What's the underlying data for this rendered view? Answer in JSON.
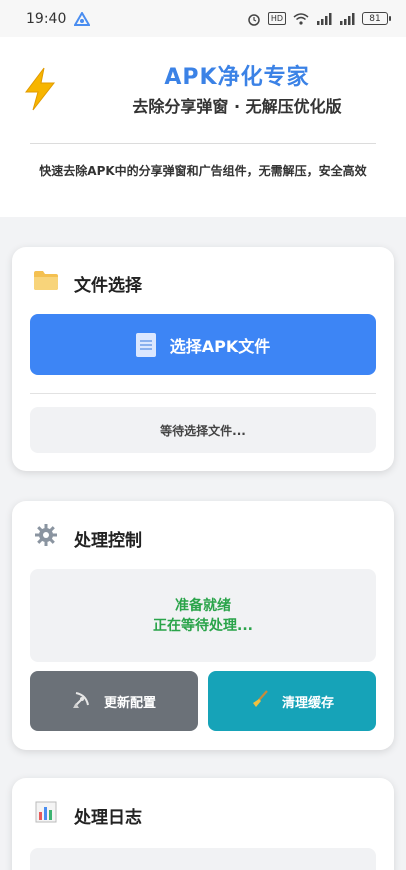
{
  "status_bar": {
    "time": "19:40",
    "hd_label": "HD",
    "battery": "81"
  },
  "header": {
    "icon": "lightning-bolt-icon",
    "title": "APK净化专家",
    "subtitle": "去除分享弹窗 · 无解压优化版",
    "description": "快速去除APK中的分享弹窗和广告组件，无需解压，安全高效"
  },
  "file_card": {
    "icon": "folder-icon",
    "title": "文件选择",
    "select_button_label": "选择APK文件",
    "select_button_icon": "document-icon",
    "status_text": "等待选择文件..."
  },
  "control_card": {
    "icon": "gear-icon",
    "title": "处理控制",
    "status_line1": "准备就绪",
    "status_line2": "正在等待处理...",
    "update_button_label": "更新配置",
    "update_button_icon": "satellite-antenna-icon",
    "clear_button_label": "清理缓存",
    "clear_button_icon": "broom-icon"
  },
  "log_card": {
    "icon": "bar-chart-icon",
    "title": "处理日志"
  },
  "colors": {
    "accent_blue": "#3d85f5",
    "title_blue": "#3b82e6",
    "status_green": "#2aa44a",
    "update_gray": "#6b7178",
    "clear_teal": "#16a3b8"
  }
}
